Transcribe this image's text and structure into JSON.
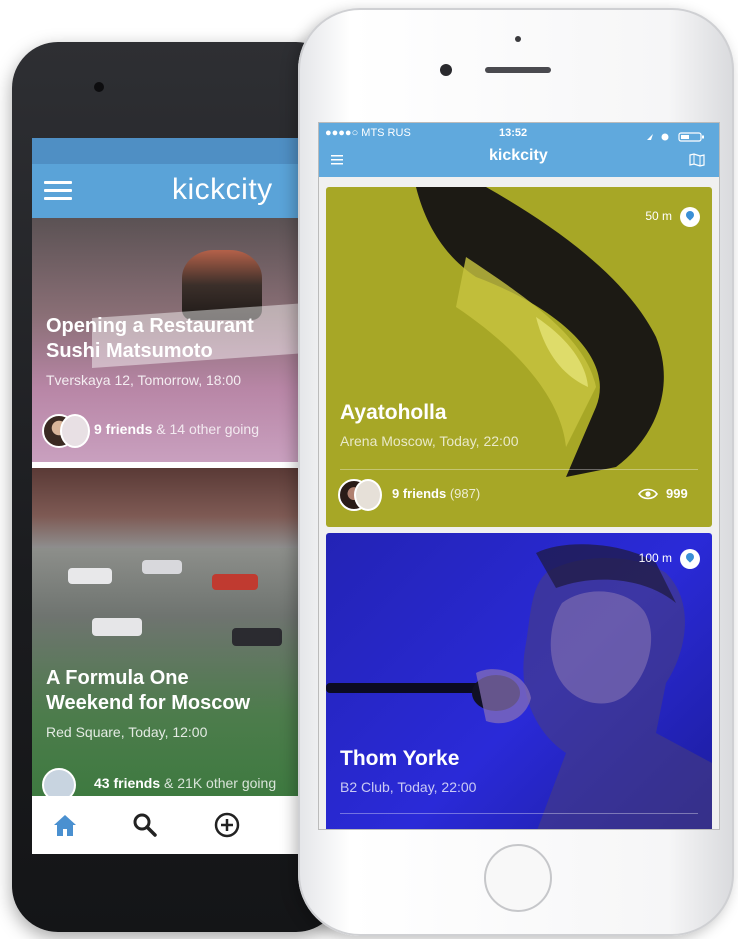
{
  "android": {
    "app_logo": "kickcity",
    "cards": [
      {
        "title_line1": "Opening a Restaurant",
        "title_line2": "Sushi Matsumoto",
        "subtitle": "Tverskaya 12, Tomorrow, 18:00",
        "friends": "9 friends",
        "others": "& 14 other going"
      },
      {
        "title_line1": "A Formula One",
        "title_line2": "Weekend for Moscow",
        "subtitle": "Red Square, Today, 12:00",
        "friends": "43 friends",
        "others": "& 21K other going"
      }
    ],
    "nav_icons": [
      "home-icon",
      "search-icon",
      "add-icon"
    ]
  },
  "iphone": {
    "carrier": "●●●●○ MTS RUS",
    "time": "13:52",
    "app_logo": "kickcity",
    "cards": [
      {
        "distance": "50 m",
        "title": "Ayatoholla",
        "subtitle": "Arena Moscow, Today, 22:00",
        "friends": "9 friends",
        "friends_total": "(987)",
        "views": "999"
      },
      {
        "distance": "100 m",
        "title": "Thom Yorke",
        "subtitle": "B2 Club, Today, 22:00"
      }
    ]
  },
  "colors": {
    "android_bar": "#5aa3d8",
    "iphone_bar": "#60a9dd",
    "card_olive": "#a7a726",
    "card_blue": "#2424c8",
    "nav_active": "#4a90d0"
  }
}
